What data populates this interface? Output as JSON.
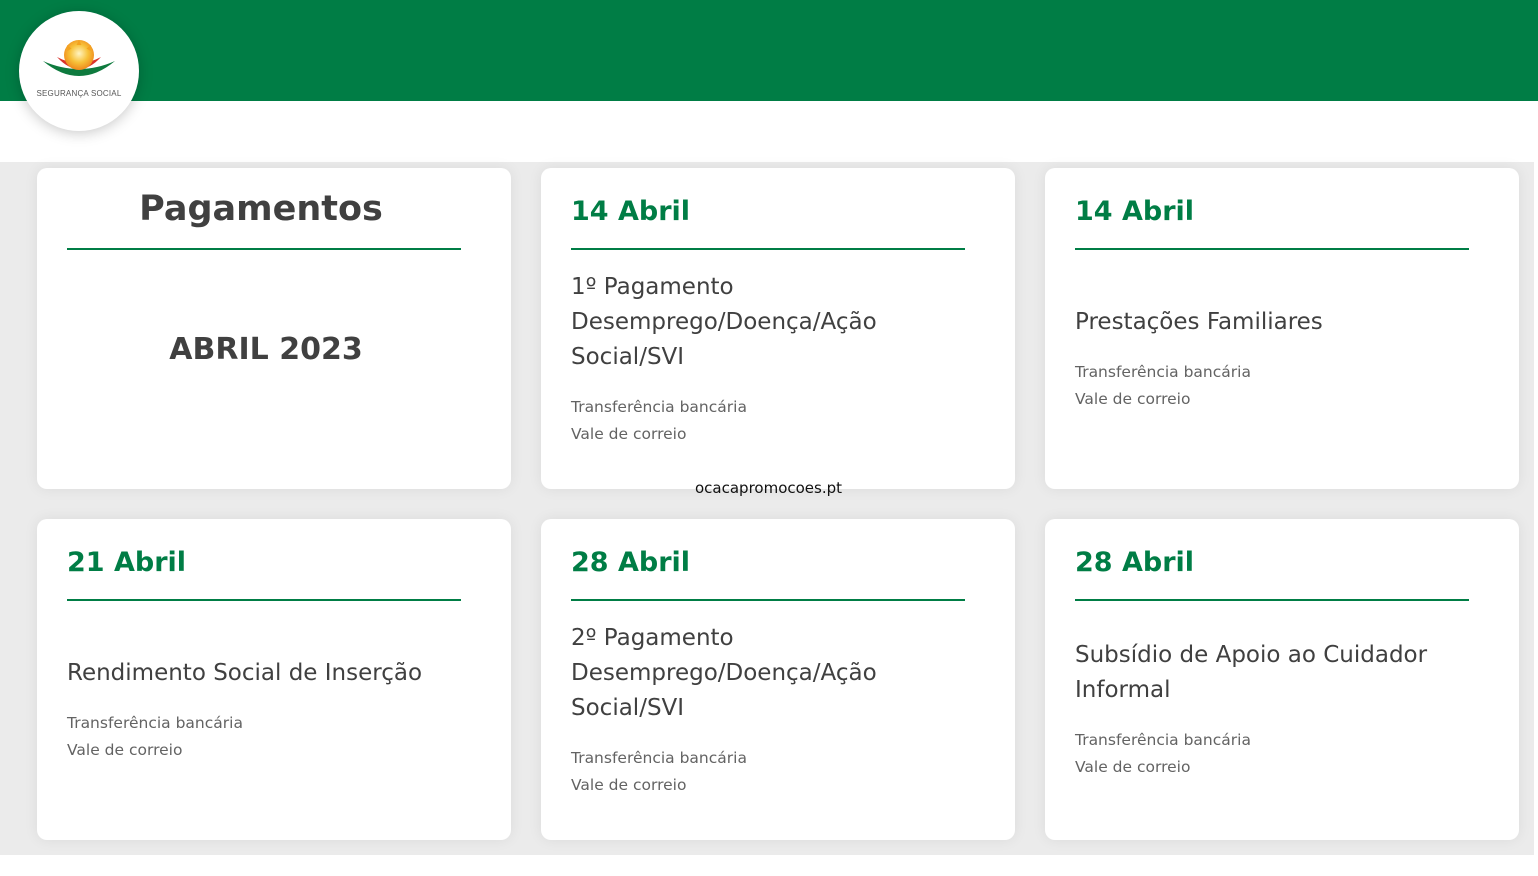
{
  "brand": {
    "name": "SEGURANÇA SOCIAL",
    "primary_color": "#007d45",
    "text_color": "#404040",
    "muted_color": "#636363"
  },
  "intro_card": {
    "heading": "Pagamentos",
    "period": "ABRIL 2023"
  },
  "watermark": "ocacapromocoes.pt",
  "payments": [
    {
      "date": "14 Abril",
      "title": "1º Pagamento Desemprego/Doença/Ação Social/SVI",
      "methods": [
        "Transferência bancária",
        "Vale de correio"
      ]
    },
    {
      "date": "14 Abril",
      "title": "Prestações Familiares",
      "methods": [
        "Transferência bancária",
        "Vale de correio"
      ]
    },
    {
      "date": "21 Abril",
      "title": "Rendimento Social de Inserção",
      "methods": [
        "Transferência bancária",
        "Vale de correio"
      ]
    },
    {
      "date": "28 Abril",
      "title": "2º Pagamento Desemprego/Doença/Ação Social/SVI",
      "methods": [
        "Transferência bancária",
        "Vale de correio"
      ]
    },
    {
      "date": "28 Abril",
      "title": "Subsídio de Apoio ao Cuidador Informal",
      "methods": [
        "Transferência bancária",
        "Vale de correio"
      ]
    }
  ]
}
